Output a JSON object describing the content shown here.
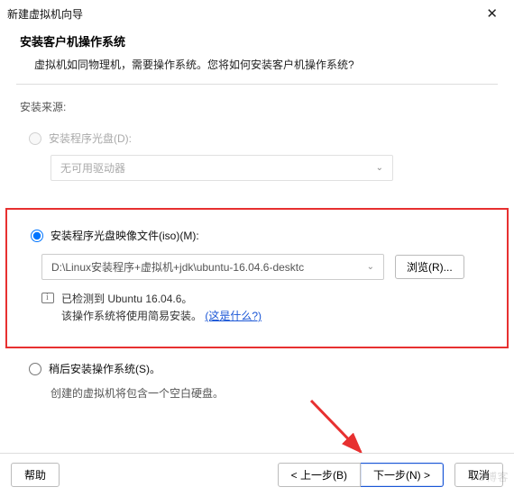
{
  "window": {
    "title": "新建虚拟机向导",
    "close": "✕"
  },
  "header": {
    "title": "安装客户机操作系统",
    "desc": "虚拟机如同物理机，需要操作系统。您将如何安装客户机操作系统?"
  },
  "source": {
    "label": "安装来源:",
    "disc": {
      "label": "安装程序光盘(D):",
      "dropdown": "无可用驱动器"
    },
    "iso": {
      "label": "安装程序光盘映像文件(iso)(M):",
      "path": "D:\\Linux安装程序+虚拟机+jdk\\ubuntu-16.04.6-desktc",
      "browse": "浏览(R)...",
      "detected_line1": "已检测到 Ubuntu 16.04.6。",
      "detected_line2": "该操作系统将使用简易安装。",
      "whatis": "(这是什么?)"
    },
    "later": {
      "label": "稍后安装操作系统(S)。",
      "desc": "创建的虚拟机将包含一个空白硬盘。"
    }
  },
  "footer": {
    "help": "帮助",
    "back": "< 上一步(B)",
    "next": "下一步(N) >",
    "cancel": "取消"
  },
  "watermark": "O博客"
}
